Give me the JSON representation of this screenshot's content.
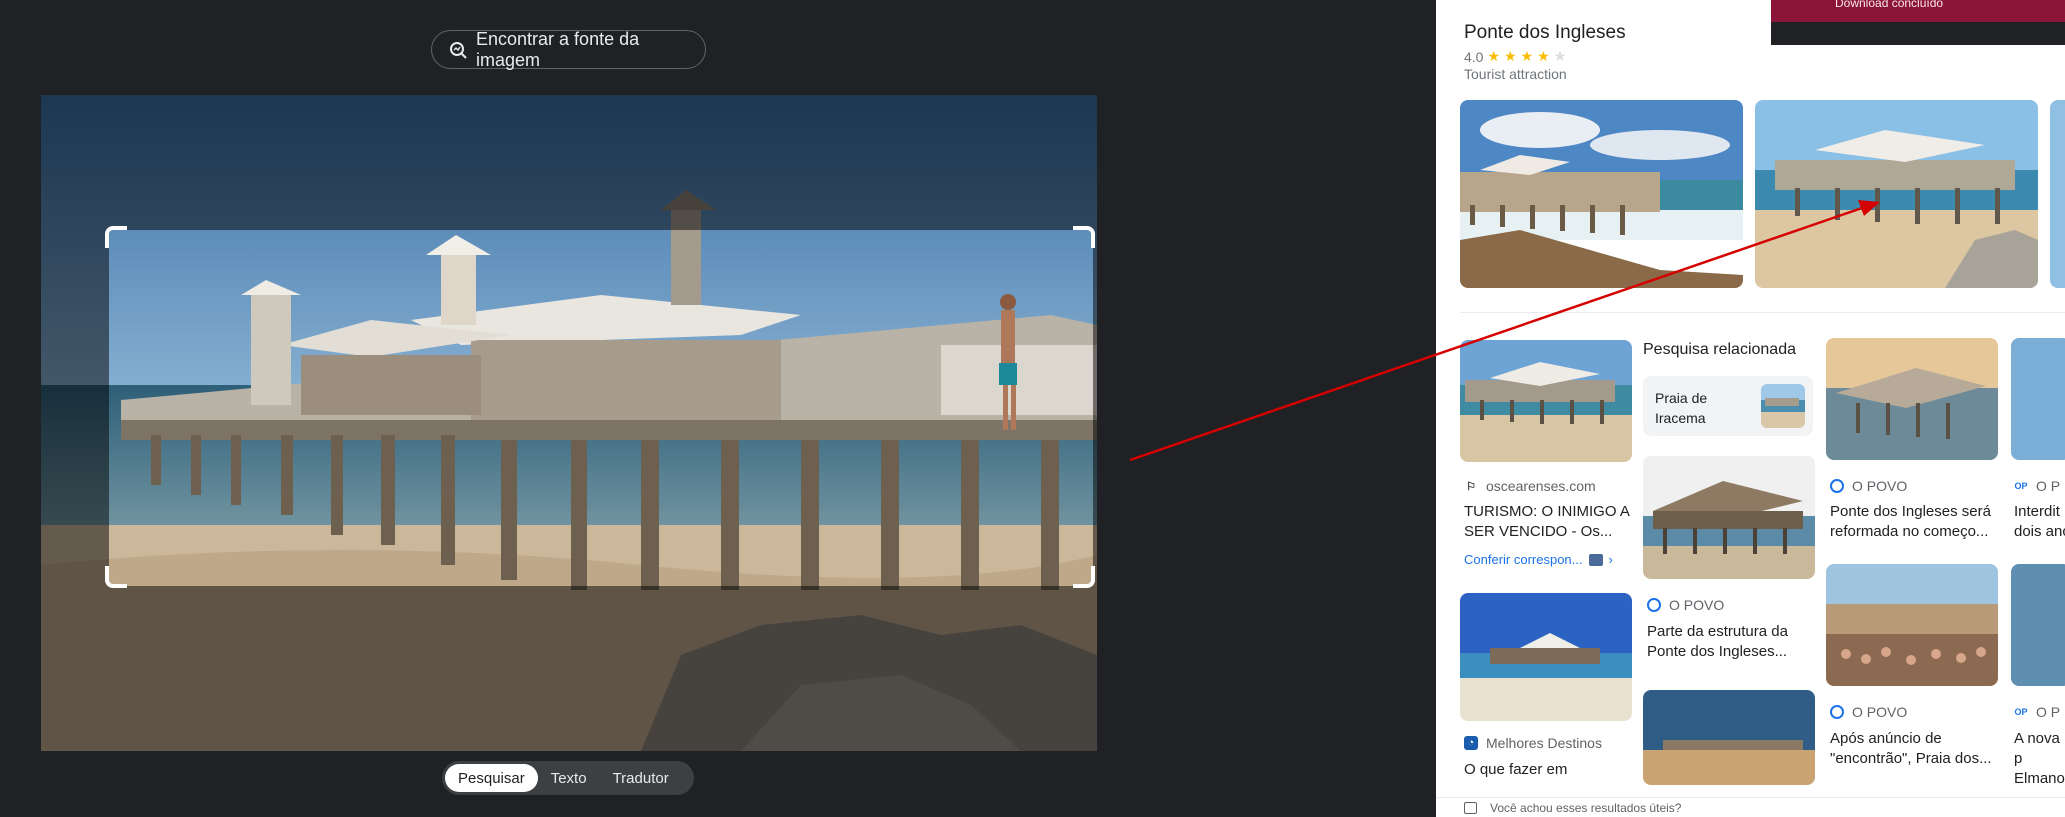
{
  "left": {
    "find_source_label": "Encontrar a fonte da imagem",
    "tabs": [
      {
        "label": "Pesquisar",
        "active": true
      },
      {
        "label": "Texto",
        "active": false
      },
      {
        "label": "Tradutor",
        "active": false
      }
    ]
  },
  "right": {
    "place": {
      "title": "Ponte dos Ingleses",
      "rating": "4.0",
      "stars": 4,
      "type": "Tourist attraction"
    },
    "related": {
      "heading": "Pesquisa relacionada",
      "chip_label": "Praia de Iracema"
    },
    "cards": [
      {
        "source": "oscearenses.com",
        "title": "TURISMO: O INIMIGO A SER VENCIDO - Os..."
      },
      {
        "source": "O POVO",
        "title": "Parte da estrutura da Ponte dos Ingleses..."
      },
      {
        "source": "O POVO",
        "title": "Ponte dos Ingleses será reformada no começo..."
      },
      {
        "source": "O P",
        "title": "Interdit dois anc"
      },
      {
        "source": "Melhores Destinos",
        "title": "O que fazer em"
      },
      {
        "source": "O POVO",
        "title": "Após anúncio de \"encontrão\", Praia dos..."
      },
      {
        "source": "O P",
        "title": "A nova p Elmano"
      }
    ],
    "conferir_label": "Conferir correspon...",
    "feedback": "Você achou esses resultados úteis?",
    "toast": "Download concluído"
  },
  "colors": {
    "accent_red": "#d50000",
    "star": "#fbbc04",
    "link_blue": "#1a73e8"
  }
}
